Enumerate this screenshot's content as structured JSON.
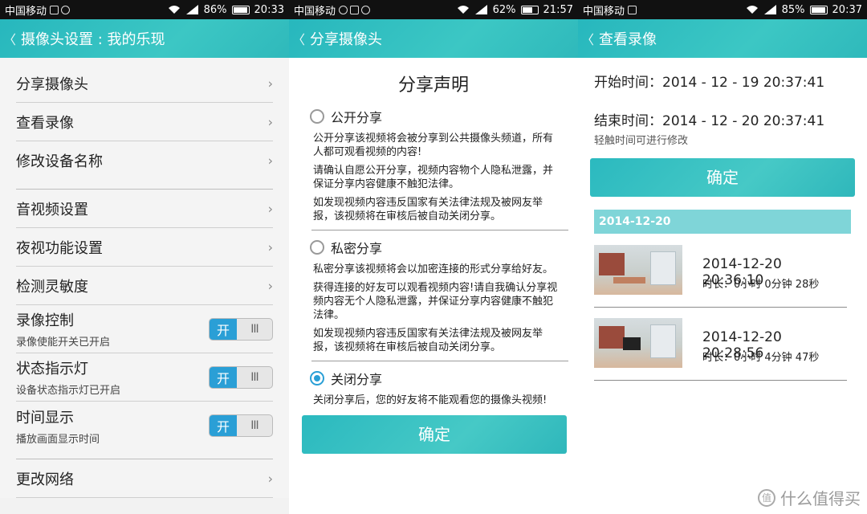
{
  "panel1": {
    "status": {
      "carrier": "中国移动",
      "battery": "86%",
      "battery_level": 0.86,
      "time": "20:33"
    },
    "title": "摄像头设置 : 我的乐现",
    "back_icon": "chevron-left-icon",
    "group1": [
      "分享摄像头",
      "查看录像",
      "修改设备名称"
    ],
    "group2": [
      "音视频设置",
      "夜视功能设置",
      "检测灵敏度"
    ],
    "toggles": [
      {
        "label": "录像控制",
        "sub": "录像使能开关已开启",
        "on_label": "开"
      },
      {
        "label": "状态指示灯",
        "sub": "设备状态指示灯已开启",
        "on_label": "开"
      },
      {
        "label": "时间显示",
        "sub": "播放画面显示时间",
        "on_label": "开"
      }
    ],
    "group3": [
      "更改网络"
    ],
    "toggle_grip": "III"
  },
  "panel2": {
    "status": {
      "carrier": "中国移动",
      "battery": "62%",
      "battery_level": 0.62,
      "time": "21:57"
    },
    "title": "分享摄像头",
    "heading": "分享声明",
    "options": [
      {
        "label": "公开分享",
        "checked": false,
        "paras": [
          "公开分享该视频将会被分享到公共摄像头频道，所有人都可观看视频的内容!",
          "请确认自愿公开分享，视频内容物个人隐私泄露，并保证分享内容健康不触犯法律。",
          "如发现视频内容违反国家有关法律法规及被网友举报，该视频将在审核后被自动关闭分享。"
        ]
      },
      {
        "label": "私密分享",
        "checked": false,
        "paras": [
          "私密分享该视频将会以加密连接的形式分享给好友。",
          "获得连接的好友可以观看视频内容!请自我确认分享视频内容无个人隐私泄露，并保证分享内容健康不触犯法律。",
          "如发现视频内容违反国家有关法律法规及被网友举报，该视频将在审核后被自动关闭分享。"
        ]
      },
      {
        "label": "关闭分享",
        "checked": true,
        "paras": [
          "关闭分享后，您的好友将不能观看您的摄像头视频!"
        ]
      }
    ],
    "confirm": "确定"
  },
  "panel3": {
    "status": {
      "carrier": "中国移动",
      "battery": "85%",
      "battery_level": 0.85,
      "time": "20:37"
    },
    "title": "查看录像",
    "start_label": "开始时间：",
    "start_value": "2014 - 12 - 19 20:37:41",
    "end_label": "结束时间：",
    "end_value": "2014 - 12 - 20 20:37:41",
    "hint": "轻触时间可进行修改",
    "confirm": "确定",
    "date_header": "2014-12-20",
    "recordings": [
      {
        "timestamp": "2014-12-20 20:36:10",
        "duration": "时长：0小时 0分钟 28秒"
      },
      {
        "timestamp": "2014-12-20 20:28:56",
        "duration": "时长：0小时 4分钟 47秒"
      }
    ]
  },
  "watermark": {
    "text": "什么值得买",
    "icon": "值"
  }
}
